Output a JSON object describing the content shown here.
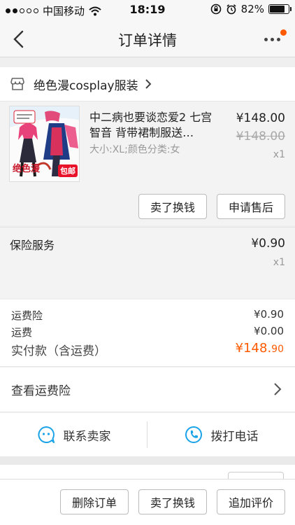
{
  "status_bar": {
    "carrier": "中国移动",
    "time": "18:19",
    "battery": "82%",
    "battery_level": 0.82
  },
  "nav": {
    "title": "订单详情"
  },
  "shop": {
    "name": "绝色漫cosplay服装"
  },
  "product": {
    "name": "中二病也要谈恋爱2 七宫智音 背带裙制服送…",
    "spec": "大小:XL;颜色分类:女",
    "price": "¥148.00",
    "original_price": "¥148.00",
    "quantity": "x1",
    "buttons": {
      "sell": "卖了换钱",
      "after_sale": "申请售后"
    },
    "thumb_text": {
      "brand": "绝色漫",
      "badge": "包邮"
    }
  },
  "insurance": {
    "label": "保险服务",
    "amount": "¥0.90",
    "quantity": "x1"
  },
  "fees": {
    "shipping_insurance_label": "运费险",
    "shipping_insurance_value": "¥0.90",
    "shipping_label": "运费",
    "shipping_value": "¥0.00",
    "total_label": "实付款（含运费）",
    "total_main": "¥148.",
    "total_cents": "90"
  },
  "view_insurance": {
    "label": "查看运费险"
  },
  "contact": {
    "seller": "联系卖家",
    "call": "拨打电话"
  },
  "bottom": {
    "delete": "删除订单",
    "sell": "卖了换钱",
    "review": "追加评价"
  },
  "colors": {
    "accent": "#ff5a00",
    "icon_blue": "#1aa3e8"
  }
}
